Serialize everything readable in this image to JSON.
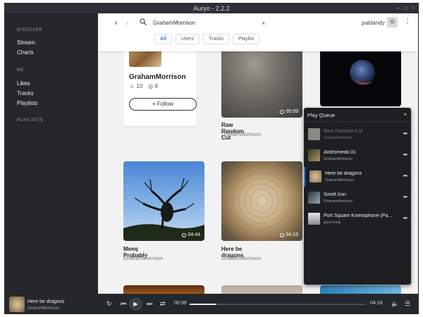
{
  "window": {
    "title": "Auryo - 2.2.2"
  },
  "sidebar": {
    "sections": [
      {
        "heading": "DISCOVER",
        "items": [
          "Stream",
          "Charts"
        ]
      },
      {
        "heading": "ME",
        "items": [
          "Likes",
          "Tracks",
          "Playlists"
        ]
      },
      {
        "heading": "PLAYLISTS",
        "items": []
      }
    ]
  },
  "search": {
    "query": "GrahamMorrison",
    "filters": [
      "All",
      "Users",
      "Tracks",
      "Playlist"
    ],
    "active_filter": "All"
  },
  "account": {
    "username": "paldandy"
  },
  "user_result": {
    "name": "GrahamMorrison",
    "followers": "10",
    "tracks": "8",
    "follow_label": "Follow"
  },
  "tracks": [
    {
      "title": "Raw Random Cut",
      "artist": "GrahamMorrison",
      "duration": "05:09"
    },
    {
      "title": "",
      "artist": "",
      "duration": ""
    },
    {
      "title": "Meeq Probably",
      "artist": "GrahamMorrison",
      "duration": "04:44"
    },
    {
      "title": "Here be dragons",
      "artist": "GrahamMorrison",
      "duration": "04:16"
    }
  ],
  "queue": {
    "title": "Play Queue",
    "items": [
      {
        "title": "Raw Random Cut",
        "artist": "GrahamMorrison"
      },
      {
        "title": "Andromeda 01",
        "artist": "GrahamMorrison"
      },
      {
        "title": "Here be dragons",
        "artist": "GrahamMorrison"
      },
      {
        "title": "Smelt Iron",
        "artist": "GrahamMorrison"
      },
      {
        "title": "Port Square Kinetophone (Pa...",
        "artist": "gonchong"
      }
    ]
  },
  "player": {
    "title": "Here be dragons",
    "artist": "GrahamMorrison",
    "current_time": "00:39",
    "total_time": "04:16",
    "progress": 0.152
  }
}
